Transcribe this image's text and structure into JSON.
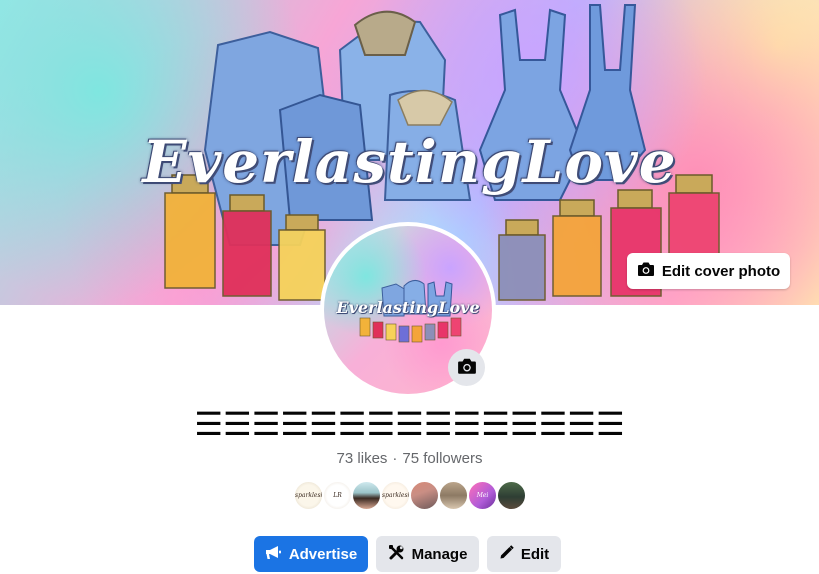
{
  "cover": {
    "title_art": "EverlastingLove",
    "edit_cover_label": "Edit cover photo"
  },
  "profile": {
    "picture_art": "EverlastingLove",
    "name": "☰☰☰☰☰☰☰☰☰☰☰☰☰☰☰",
    "likes": "73 likes",
    "separator": "·",
    "followers": "75 followers"
  },
  "avatars": [
    {
      "name": "friend-avatar-1",
      "text": "sparkleshade"
    },
    {
      "name": "friend-avatar-2",
      "text": "LR"
    },
    {
      "name": "friend-avatar-3",
      "text": ""
    },
    {
      "name": "friend-avatar-4",
      "text": "sparkleshade"
    },
    {
      "name": "friend-avatar-5",
      "text": ""
    },
    {
      "name": "friend-avatar-6",
      "text": ""
    },
    {
      "name": "friend-avatar-7",
      "text": "Mei"
    },
    {
      "name": "friend-avatar-8",
      "text": ""
    }
  ],
  "actions": {
    "advertise_label": "Advertise",
    "manage_label": "Manage",
    "edit_label": "Edit"
  },
  "colors": {
    "primary": "#1b74e4",
    "secondary_bg": "#e4e6eb",
    "muted_text": "#65676b"
  },
  "icons": {
    "edit_cover": "camera-icon",
    "profile_camera": "camera-icon",
    "advertise": "megaphone-icon",
    "manage": "tools-icon",
    "edit": "pencil-icon"
  }
}
